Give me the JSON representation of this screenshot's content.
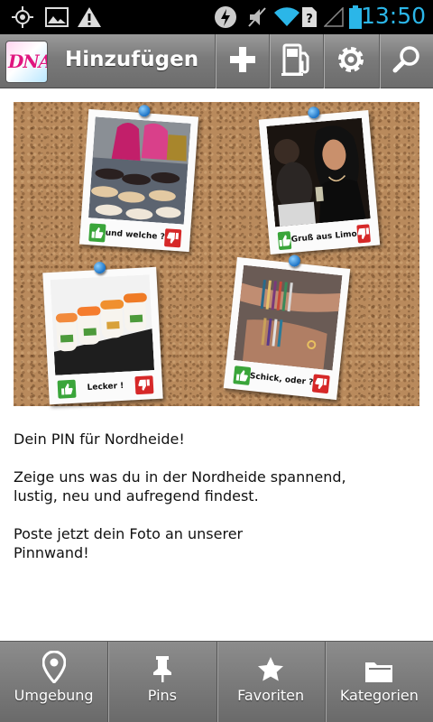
{
  "status_bar": {
    "time": "13:50",
    "icons": [
      "gps-icon",
      "image-icon",
      "warning-icon",
      "flash-icon",
      "mute-icon",
      "wifi-icon",
      "no-sim-icon",
      "signal-icon",
      "battery-icon"
    ],
    "accent_color": "#2bb6e8"
  },
  "action_bar": {
    "logo_text": "DNA",
    "title": "Hinzufügen",
    "buttons": [
      "add-icon",
      "fuel-icon",
      "gear-icon",
      "search-icon"
    ]
  },
  "pinboard": {
    "photos": [
      {
        "caption": "und welche ?"
      },
      {
        "caption": "Gruß aus Limo"
      },
      {
        "caption": "Lecker !"
      },
      {
        "caption": "Schick, oder ?"
      }
    ]
  },
  "content": {
    "headline": "Dein PIN für Nordheide!",
    "paragraph1": "Zeige uns was du in der Nordheide spannend, lustig, neu und aufregend findest.",
    "paragraph2": "Poste jetzt dein Foto an unserer Pinnwand!"
  },
  "bottom_nav": {
    "items": [
      {
        "label": "Umgebung",
        "icon": "location-pin-icon"
      },
      {
        "label": "Pins",
        "icon": "pushpin-icon"
      },
      {
        "label": "Favoriten",
        "icon": "star-icon"
      },
      {
        "label": "Kategorien",
        "icon": "folder-icon"
      }
    ]
  }
}
